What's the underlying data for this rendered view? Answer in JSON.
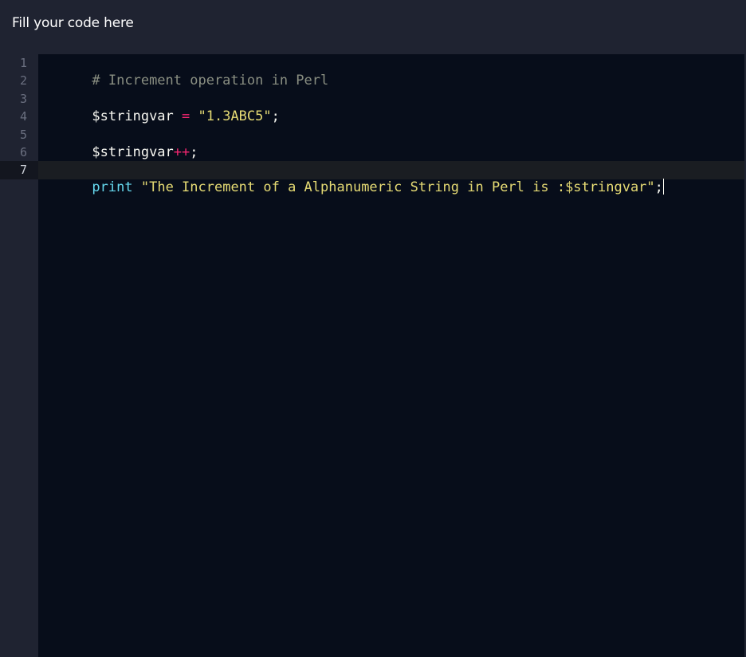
{
  "header": {
    "title": "Fill your code here"
  },
  "editor": {
    "line_numbers": [
      "1",
      "2",
      "3",
      "4",
      "5",
      "6",
      "7"
    ],
    "active_line": "7",
    "lines": {
      "l1": {
        "comment": "# Increment operation in Perl"
      },
      "l3": {
        "var": "$stringvar",
        "op": " = ",
        "str": "\"1.3ABC5\"",
        "punc": ";"
      },
      "l5": {
        "var": "$stringvar",
        "op": "++",
        "punc": ";"
      },
      "l7": {
        "kw": "print",
        "str": "\"The Increment of a Alphanumeric String in Perl is :$stringvar\"",
        "punc": ";"
      }
    }
  },
  "colors": {
    "background": "#1f2331",
    "editor_background": "#070d1a",
    "comment": "#8a8f82",
    "operator": "#f92672",
    "string": "#e6db74",
    "keyword": "#66d9ef"
  }
}
